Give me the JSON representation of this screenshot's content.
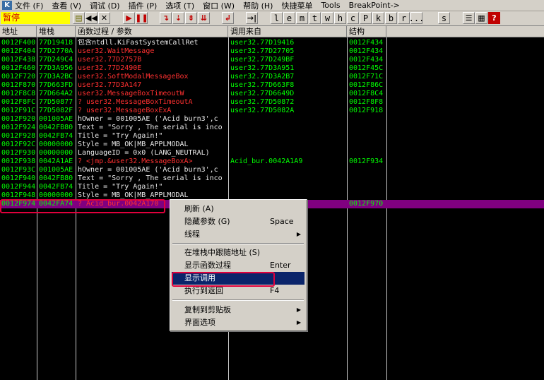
{
  "menubar": {
    "app_icon": "K",
    "items": [
      "文件 (F)",
      "查看 (V)",
      "调试 (D)",
      "插件 (P)",
      "选项 (T)",
      "窗口 (W)",
      "帮助 (H)",
      "快捷菜单",
      "Tools",
      "BreakPoint->"
    ]
  },
  "toolbar": {
    "status": "暂停",
    "letters": [
      "l",
      "e",
      "m",
      "t",
      "w",
      "h",
      "c",
      "P",
      "k",
      "b",
      "r",
      "...",
      "s"
    ],
    "help": "?"
  },
  "columns": [
    "地址",
    "堆栈",
    "函数过程 / 参数",
    "调用来自",
    "结构"
  ],
  "rows": [
    {
      "addr": "0012F400",
      "stack": "77D19418",
      "proc": "包含ntdll.KiFastSystemCallRet",
      "from": "user32.77D19416",
      "frame": "0012F434",
      "pc": "w"
    },
    {
      "addr": "0012F404",
      "stack": "77D2770A",
      "proc": "user32.WaitMessage",
      "from": "user32.77D27705",
      "frame": "0012F434",
      "pc": "r"
    },
    {
      "addr": "0012F438",
      "stack": "77D249C4",
      "proc": "user32.77D2757B",
      "from": "user32.77D249BF",
      "frame": "0012F434",
      "pc": "r"
    },
    {
      "addr": "0012F460",
      "stack": "77D3A956",
      "proc": "user32.77D2490E",
      "from": "user32.77D3A951",
      "frame": "0012F45C",
      "pc": "r"
    },
    {
      "addr": "0012F720",
      "stack": "77D3A2BC",
      "proc": "user32.SoftModalMessageBox",
      "from": "user32.77D3A2B7",
      "frame": "0012F71C",
      "pc": "r"
    },
    {
      "addr": "0012F870",
      "stack": "77D663FD",
      "proc": "user32.77D3A147",
      "from": "user32.77D663F8",
      "frame": "0012F86C",
      "pc": "r"
    },
    {
      "addr": "0012F8C8",
      "stack": "77D664A2",
      "proc": "user32.MessageBoxTimeoutW",
      "from": "user32.77D6649D",
      "frame": "0012F8C4",
      "pc": "r"
    },
    {
      "addr": "0012F8FC",
      "stack": "77D50877",
      "proc": "? user32.MessageBoxTimeoutA",
      "from": "user32.77D50872",
      "frame": "0012F8F8",
      "pc": "r"
    },
    {
      "addr": "0012F91C",
      "stack": "77D5082F",
      "proc": "? user32.MessageBoxExA",
      "from": "user32.77D5082A",
      "frame": "0012F918",
      "pc": "r"
    },
    {
      "addr": "0012F920",
      "stack": "001005AE",
      "proc": "  hOwner = 001005AE ('Acid burn3',c",
      "from": "",
      "frame": "",
      "pc": "w"
    },
    {
      "addr": "0012F924",
      "stack": "0042FB80",
      "proc": "  Text = \"Sorry , The serial is inco",
      "from": "",
      "frame": "",
      "pc": "w"
    },
    {
      "addr": "0012F928",
      "stack": "0042FB74",
      "proc": "  Title = \"Try Again!\"",
      "from": "",
      "frame": "",
      "pc": "w"
    },
    {
      "addr": "0012F92C",
      "stack": "00000000",
      "proc": "  Style = MB_OK|MB_APPLMODAL",
      "from": "",
      "frame": "",
      "pc": "w"
    },
    {
      "addr": "0012F930",
      "stack": "00000000",
      "proc": "  LanguageID = 0x0 (LANG_NEUTRAL)",
      "from": "",
      "frame": "",
      "pc": "w"
    },
    {
      "addr": "0012F938",
      "stack": "0042A1AE",
      "proc": "? <jmp.&user32.MessageBoxA>",
      "from": "Acid_bur.0042A1A9",
      "frame": "0012F934",
      "pc": "r"
    },
    {
      "addr": "0012F93C",
      "stack": "001005AE",
      "proc": "  hOwner = 001005AE ('Acid burn3',c",
      "from": "",
      "frame": "",
      "pc": "w"
    },
    {
      "addr": "0012F940",
      "stack": "0042FB80",
      "proc": "  Text = \"Sorry , The serial is inco",
      "from": "",
      "frame": "",
      "pc": "w"
    },
    {
      "addr": "0012F944",
      "stack": "0042FB74",
      "proc": "  Title = \"Try Again!\"",
      "from": "",
      "frame": "",
      "pc": "w"
    },
    {
      "addr": "0012F948",
      "stack": "00000000",
      "proc": "  Style = MB_OK|MB_APPLMODAL",
      "from": "",
      "frame": "",
      "pc": "w"
    },
    {
      "addr": "0012F974",
      "stack": "0042FA74",
      "proc": "? Acid_bur.0042A170",
      "from": "",
      "frame": "0012F970",
      "pc": "r",
      "selected": true
    }
  ],
  "context_menu": {
    "items": [
      {
        "label": "刷新 (A)",
        "shortcut": "",
        "submenu": false
      },
      {
        "label": "隐藏参数 (G)",
        "shortcut": "Space",
        "submenu": false
      },
      {
        "label": "线程",
        "shortcut": "",
        "submenu": true
      },
      {
        "label": "在堆栈中跟随地址 (S)",
        "shortcut": "",
        "submenu": false
      },
      {
        "label": "显示函数过程",
        "shortcut": "Enter",
        "submenu": false
      },
      {
        "label": "显示调用",
        "shortcut": "",
        "submenu": false,
        "active": true
      },
      {
        "label": "执行到返回",
        "shortcut": "F4",
        "submenu": false
      },
      {
        "label": "复制到剪贴板",
        "shortcut": "",
        "submenu": true
      },
      {
        "label": "界面选项",
        "shortcut": "",
        "submenu": true
      }
    ]
  },
  "colors": {
    "highlight_border": "#e0003c",
    "selection": "#800080",
    "menu_active": "#0a246a",
    "green_text": "#00ff00",
    "red_text": "#ff3030"
  }
}
